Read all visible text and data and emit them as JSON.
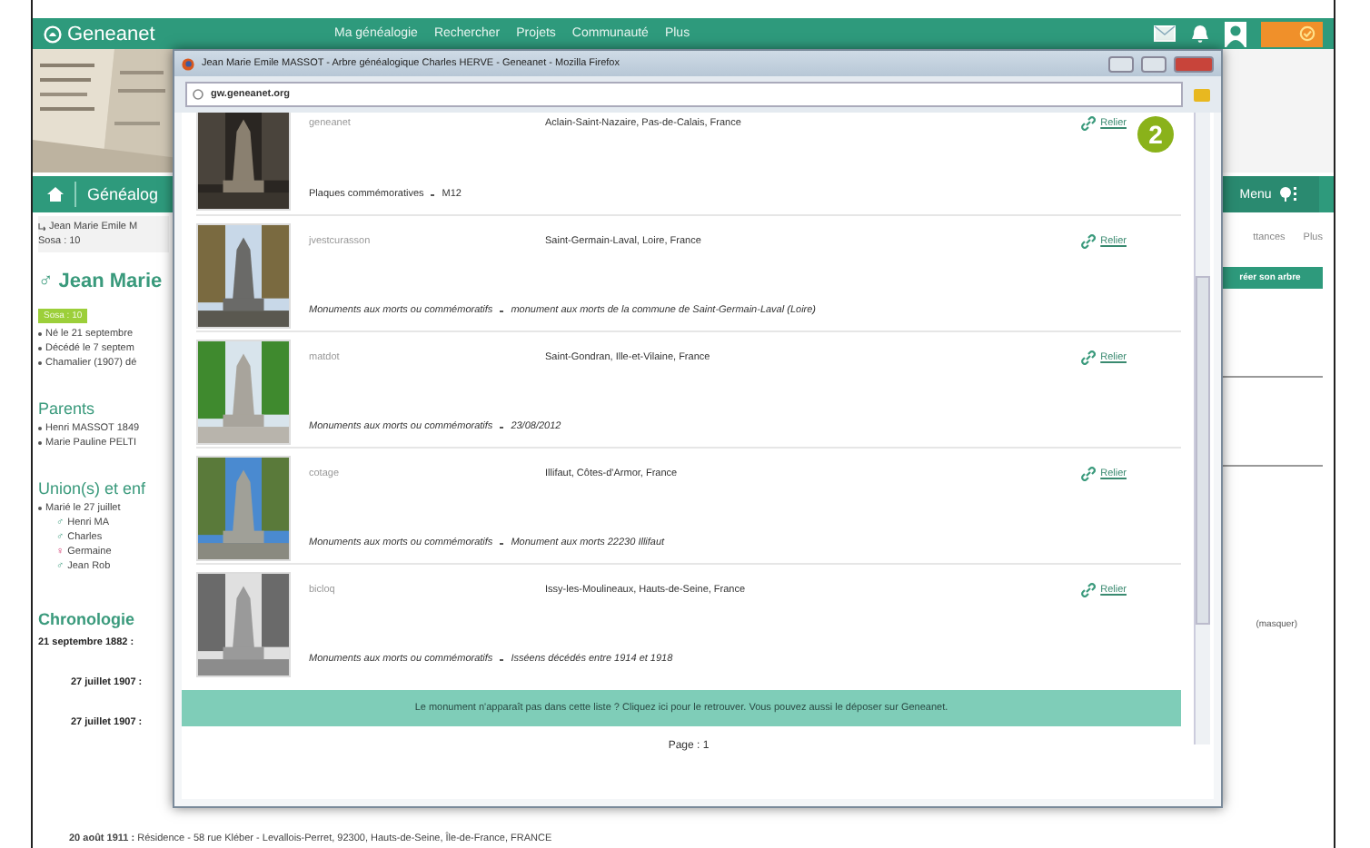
{
  "site_nav": {
    "logo": "Geneanet",
    "items": [
      "Ma généalogie",
      "Rechercher",
      "Projets",
      "Communauté",
      "Plus"
    ]
  },
  "page": {
    "section_title": "Généalog",
    "breadcrumb": "Jean Marie Emile M",
    "breadcrumb_sosa": "Sosa : 10",
    "person_sign": "♂",
    "person_name": "Jean Marie",
    "sosa_badge": "Sosa : 10",
    "facts": [
      "Né le 21 septembre",
      "Décédé le 7 septem",
      "Chamalier (1907) dé"
    ],
    "parents_heading": "Parents",
    "parents": [
      "Henri MASSOT 1849",
      "Marie Pauline PELTI"
    ],
    "unions_heading": "Union(s) et enf",
    "marriage": "Marié le 27 juillet",
    "children": [
      {
        "sign": "♂",
        "name": "Henri MA",
        "kind": "male"
      },
      {
        "sign": "♂",
        "name": "Charles",
        "kind": "male"
      },
      {
        "sign": "♀",
        "name": "Germaine",
        "kind": "female"
      },
      {
        "sign": "♂",
        "name": "Jean Rob",
        "kind": "male"
      }
    ],
    "chronology_heading": "Chronologie",
    "chronology": [
      "21 septembre 1882 :",
      "27 juillet 1907 :",
      "27 juillet 1907 :"
    ],
    "last_event_date": "20 août 1911 :",
    "last_event_text": "Résidence - 58 rue Kléber - Levallois-Perret, 92300, Hauts-de-Seine, Île-de-France, FRANCE"
  },
  "right_panel": {
    "menu_button": "Menu",
    "tab_partial": "ttances",
    "tab_more": "Plus",
    "create_button": "réer son arbre",
    "hide_link": "(masquer)"
  },
  "popup": {
    "title": "Jean Marie Emile MASSOT - Arbre généalogique Charles HERVE - Geneanet - Mozilla Firefox",
    "url_domain": "gw.geneanet.org",
    "badge": "2",
    "entries": [
      {
        "user": "geneanet",
        "place": "Aclain-Saint-Nazaire, Pas-de-Calais, France",
        "category": "Plaques commémoratives",
        "detail": "M12",
        "italic": false,
        "link": "Relier"
      },
      {
        "user": "jvestcurasson",
        "place": "Saint-Germain-Laval, Loire, France",
        "category": "Monuments aux morts ou commémoratifs",
        "detail": "monument aux morts de la commune de Saint-Germain-Laval (Loire)",
        "italic": true,
        "link": "Relier"
      },
      {
        "user": "matdot",
        "place": "Saint-Gondran, Ille-et-Vilaine, France",
        "category": "Monuments aux morts ou commémoratifs",
        "detail": "23/08/2012",
        "italic": true,
        "link": "Relier"
      },
      {
        "user": "cotage",
        "place": "Illifaut, Côtes-d'Armor, France",
        "category": "Monuments aux morts ou commémoratifs",
        "detail": "Monument aux morts 22230 Illifaut",
        "italic": true,
        "link": "Relier"
      },
      {
        "user": "bicloq",
        "place": "Issy-les-Moulineaux, Hauts-de-Seine, France",
        "category": "Monuments aux morts ou commémoratifs",
        "detail": "Isséens décédés entre 1914 et 1918",
        "italic": true,
        "link": "Relier"
      }
    ],
    "banner": "Le monument n'apparaît pas dans cette liste ? Cliquez ici pour le retrouver. Vous pouvez aussi le déposer sur Geneanet.",
    "page_label": "Page : 1"
  }
}
